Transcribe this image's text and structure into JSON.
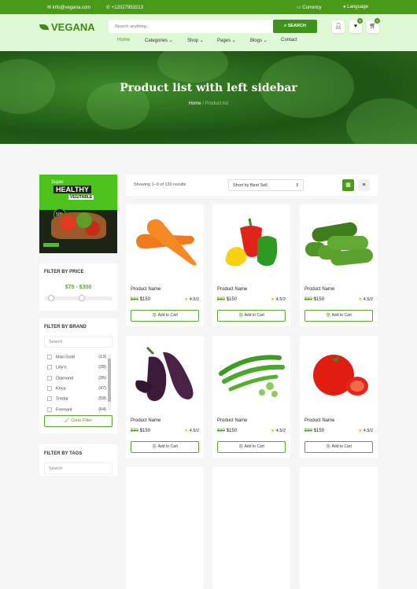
{
  "topbar": {
    "email": "info@vegana.com",
    "phone": "+12027953213",
    "currency": "Currency",
    "language": "Language"
  },
  "header": {
    "logo": "VEGANA",
    "search_placeholder": "Search anything...",
    "search_button": "SEARCH",
    "wishlist_count": "0",
    "cart_count": "0",
    "nav": [
      "Home",
      "Categories",
      "Shop",
      "Pages",
      "Blogs",
      "Contact"
    ]
  },
  "hero": {
    "title": "Product list with left sidebar",
    "breadcrumb": [
      "Home",
      "Product list"
    ]
  },
  "sidebar": {
    "banner": {
      "line1": "Super",
      "line2": "HEALTHY",
      "line3": "VEGITABLE",
      "discount": "50%"
    },
    "price": {
      "title": "FILTER BY PRICE",
      "range": "$75 - $300",
      "min_fraction": 0.1,
      "max_fraction": 0.55
    },
    "brand": {
      "title": "FILTER BY BRAND",
      "search_placeholder": "Search",
      "items": [
        {
          "name": "Mari Gold",
          "count": "(13)"
        },
        {
          "name": "Lilly's",
          "count": "(28)"
        },
        {
          "name": "Diamond",
          "count": "(35)"
        },
        {
          "name": "Keya",
          "count": "(47)"
        },
        {
          "name": "Tredar",
          "count": "(59)"
        },
        {
          "name": "Fremant",
          "count": "(64)"
        }
      ],
      "clear": "Clear Filter"
    },
    "tags": {
      "title": "FILTER BY TAGS",
      "search_placeholder": "Search"
    }
  },
  "toolbar": {
    "results": "Showing 1–9 of 130 results",
    "sort": "Short by Best Sell"
  },
  "colors": {
    "brand": "#4a9a1a",
    "header_bg": "#dff8d5"
  },
  "products": [
    {
      "name": "Product Name",
      "old_price": "$80",
      "price": "$150",
      "rating": "4.5/2",
      "cart": "Add to Cart",
      "image": "carrot"
    },
    {
      "name": "Product Name",
      "old_price": "$80",
      "price": "$150",
      "rating": "4.5/2",
      "cart": "Add to Cart",
      "image": "bell-peppers"
    },
    {
      "name": "Product Name",
      "old_price": "$80",
      "price": "$150",
      "rating": "4.5/2",
      "cart": "Add to Cart",
      "image": "cucumbers"
    },
    {
      "name": "Product Name",
      "old_price": "$80",
      "price": "$150",
      "rating": "4.5/2",
      "cart": "Add to Cart",
      "image": "eggplant"
    },
    {
      "name": "Product Name",
      "old_price": "$80",
      "price": "$150",
      "rating": "4.5/2",
      "cart": "Add to Cart",
      "image": "green-beans"
    },
    {
      "name": "Product Name",
      "old_price": "$80",
      "price": "$150",
      "rating": "4.5/2",
      "cart": "Add to Cart",
      "image": "tomato"
    }
  ]
}
